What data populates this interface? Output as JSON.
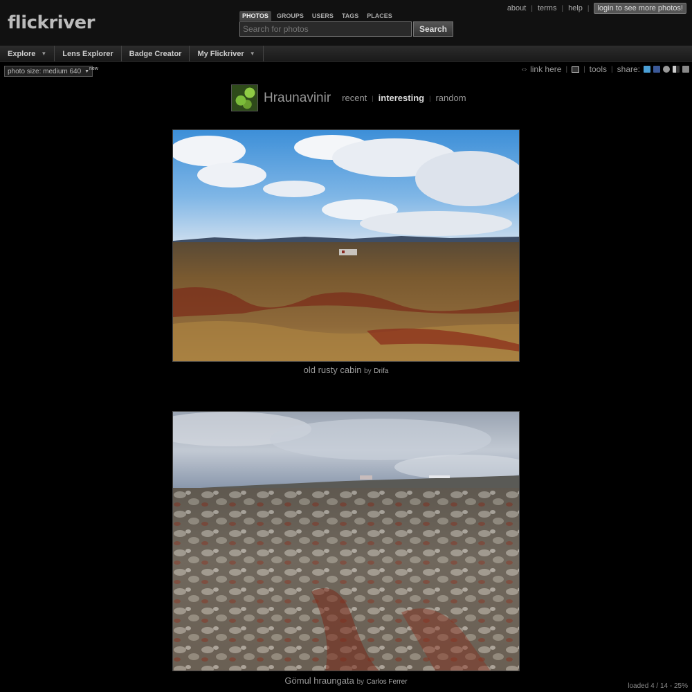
{
  "header": {
    "logo": "flickriver",
    "search_tabs": [
      "PHOTOS",
      "GROUPS",
      "USERS",
      "TAGS",
      "PLACES"
    ],
    "search_placeholder": "Search for photos",
    "search_button": "Search",
    "links": {
      "about": "about",
      "terms": "terms",
      "help": "help"
    },
    "login_button": "login to see more photos!"
  },
  "nav": {
    "explore": "Explore",
    "lens_explorer": "Lens Explorer",
    "badge_creator": "Badge Creator",
    "my_flickriver": "My Flickriver"
  },
  "toolbar": {
    "photo_size": "photo size: medium 640",
    "new_badge": "new",
    "link_here": "link here",
    "tools": "tools",
    "share": "share:"
  },
  "group": {
    "name": "Hraunavinir",
    "tabs": {
      "recent": "recent",
      "interesting": "interesting",
      "random": "random"
    }
  },
  "photos": [
    {
      "title": "old rusty cabin",
      "by": "by",
      "author": "Drifa"
    },
    {
      "title": "Gömul hraungata",
      "by": "by",
      "author": "Carlos Ferrer"
    }
  ],
  "status": "loaded 4 / 14 - 25%",
  "colors": {
    "twitter": "#4a9fd6",
    "facebook": "#3b5998",
    "stumble": "#999999",
    "delicious": "#cccccc",
    "other": "#888888"
  }
}
